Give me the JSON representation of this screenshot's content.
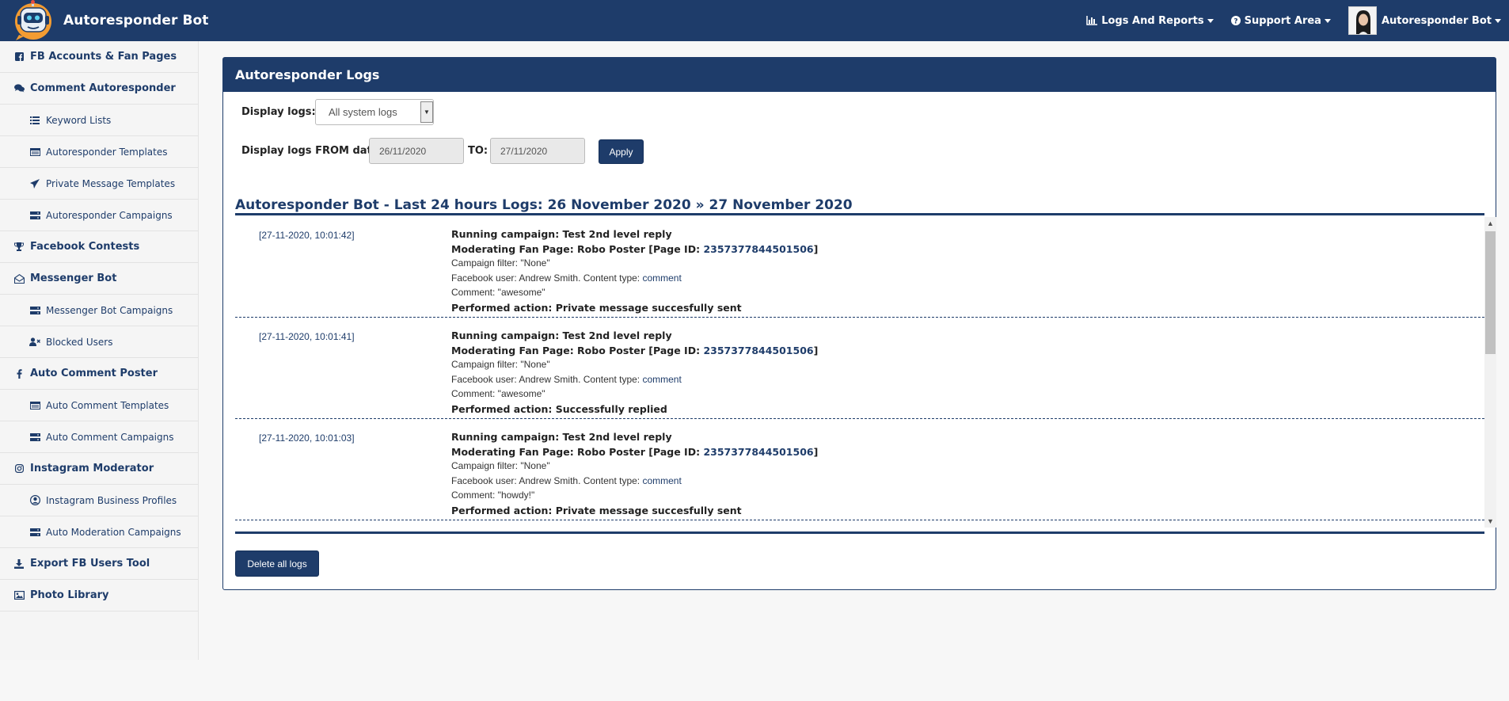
{
  "app": {
    "title": "Autoresponder Bot"
  },
  "nav": {
    "logs_reports": "Logs And Reports",
    "support_area": "Support Area",
    "user_name": "Autoresponder Bot"
  },
  "sidebar": {
    "items": [
      {
        "label": "FB Accounts & Fan Pages",
        "icon": "facebook-square-icon"
      },
      {
        "label": "Comment Autoresponder",
        "icon": "comments-icon"
      },
      {
        "label": "Keyword Lists",
        "icon": "list-icon"
      },
      {
        "label": "Autoresponder Templates",
        "icon": "template-icon"
      },
      {
        "label": "Private Message Templates",
        "icon": "paper-plane-icon"
      },
      {
        "label": "Autoresponder Campaigns",
        "icon": "server-icon"
      },
      {
        "label": "Facebook Contests",
        "icon": "trophy-icon"
      },
      {
        "label": "Messenger Bot",
        "icon": "envelope-open-icon"
      },
      {
        "label": "Messenger Bot Campaigns",
        "icon": "server-icon"
      },
      {
        "label": "Blocked Users",
        "icon": "user-times-icon"
      },
      {
        "label": "Auto Comment Poster",
        "icon": "facebook-f-icon"
      },
      {
        "label": "Auto Comment Templates",
        "icon": "template-icon"
      },
      {
        "label": "Auto Comment Campaigns",
        "icon": "server-icon"
      },
      {
        "label": "Instagram Moderator",
        "icon": "instagram-icon"
      },
      {
        "label": "Instagram Business Profiles",
        "icon": "user-circle-icon"
      },
      {
        "label": "Auto Moderation Campaigns",
        "icon": "server-icon"
      },
      {
        "label": "Export FB Users Tool",
        "icon": "download-icon"
      },
      {
        "label": "Photo Library",
        "icon": "image-icon"
      }
    ]
  },
  "panel": {
    "title": "Autoresponder Logs",
    "display_logs_label": "Display logs:",
    "display_logs_value": "All system logs",
    "from_label": "Display logs FROM date:",
    "from_value": "26/11/2020",
    "to_label": "TO:",
    "to_value": "27/11/2020",
    "apply_label": "Apply",
    "logs_title": "Autoresponder Bot - Last 24 hours Logs: 26 November 2020  »  27 November 2020",
    "delete_label": "Delete all logs"
  },
  "logs": [
    {
      "time": "[27-11-2020, 10:01:42]",
      "campaign": "Running campaign: Test 2nd level reply",
      "page_prefix": "Moderating Fan Page: Robo Poster [Page ID: ",
      "page_id": "2357377844501506",
      "page_suffix": "]",
      "filter": "Campaign filter: \"None\"",
      "user": "Facebook user: Andrew Smith.  Content type: ",
      "content_type": "comment",
      "comment": "Comment: \"awesome\"",
      "action": "Performed action: Private message succesfully sent"
    },
    {
      "time": "[27-11-2020, 10:01:41]",
      "campaign": "Running campaign: Test 2nd level reply",
      "page_prefix": "Moderating Fan Page: Robo Poster [Page ID: ",
      "page_id": "2357377844501506",
      "page_suffix": "]",
      "filter": "Campaign filter: \"None\"",
      "user": "Facebook user: Andrew Smith.  Content type: ",
      "content_type": "comment",
      "comment": "Comment: \"awesome\"",
      "action": "Performed action: Successfully replied"
    },
    {
      "time": "[27-11-2020, 10:01:03]",
      "campaign": "Running campaign: Test 2nd level reply",
      "page_prefix": "Moderating Fan Page: Robo Poster [Page ID: ",
      "page_id": "2357377844501506",
      "page_suffix": "]",
      "filter": "Campaign filter: \"None\"",
      "user": "Facebook user: Andrew Smith.  Content type: ",
      "content_type": "comment",
      "comment": "Comment: \"howdy!\"",
      "action": "Performed action: Private message succesfully sent"
    }
  ],
  "colors": {
    "primary": "#1e3c6a",
    "logo_orange": "#f39c32",
    "sidebar_bg": "#f5f5f5"
  }
}
